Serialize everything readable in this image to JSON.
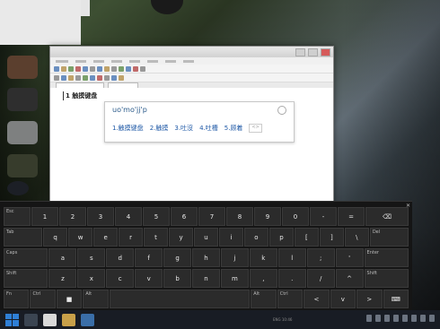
{
  "document": {
    "line_text": "1 触摸键盘"
  },
  "ime": {
    "input": "uo'mo'jj'p",
    "candidates": [
      "1.触摸键盘",
      "2.触摸",
      "3.吐沒",
      "4.吐槽",
      "5.顾着"
    ],
    "more_label": "<>"
  },
  "keyboard": {
    "rows": [
      [
        {
          "t": "Esc"
        },
        {
          "t": "1"
        },
        {
          "t": "2"
        },
        {
          "t": "3"
        },
        {
          "t": "4"
        },
        {
          "t": "5"
        },
        {
          "t": "6"
        },
        {
          "t": "7"
        },
        {
          "t": "8"
        },
        {
          "t": "9"
        },
        {
          "t": "0"
        },
        {
          "t": "-"
        },
        {
          "t": "="
        },
        {
          "t": "⌫"
        }
      ],
      [
        {
          "t": "Tab"
        },
        {
          "t": "q"
        },
        {
          "t": "w"
        },
        {
          "t": "e"
        },
        {
          "t": "r"
        },
        {
          "t": "t"
        },
        {
          "t": "y"
        },
        {
          "t": "u"
        },
        {
          "t": "i"
        },
        {
          "t": "o"
        },
        {
          "t": "p"
        },
        {
          "t": "["
        },
        {
          "t": "]"
        },
        {
          "t": "\\"
        },
        {
          "t": "Del"
        }
      ],
      [
        {
          "t": "Caps"
        },
        {
          "t": "a"
        },
        {
          "t": "s"
        },
        {
          "t": "d"
        },
        {
          "t": "f"
        },
        {
          "t": "g"
        },
        {
          "t": "h"
        },
        {
          "t": "j"
        },
        {
          "t": "k"
        },
        {
          "t": "l"
        },
        {
          "t": ";"
        },
        {
          "t": "'"
        },
        {
          "t": "Enter"
        }
      ],
      [
        {
          "t": "Shift"
        },
        {
          "t": "z"
        },
        {
          "t": "x"
        },
        {
          "t": "c"
        },
        {
          "t": "v"
        },
        {
          "t": "b"
        },
        {
          "t": "n"
        },
        {
          "t": "m"
        },
        {
          "t": ","
        },
        {
          "t": "."
        },
        {
          "t": "/"
        },
        {
          "t": "^"
        },
        {
          "t": "Shift"
        }
      ],
      [
        {
          "t": "Fn"
        },
        {
          "t": "Ctrl"
        },
        {
          "t": "■"
        },
        {
          "t": "Alt"
        },
        {
          "t": ""
        },
        {
          "t": "Alt"
        },
        {
          "t": "Ctrl"
        },
        {
          "t": "<"
        },
        {
          "t": "v"
        },
        {
          "t": ">"
        },
        {
          "t": "⌨"
        }
      ]
    ]
  },
  "tray": {
    "text": "ENG 10:46"
  },
  "colors": {
    "keyboard_bg": "#151515",
    "key_bg": "#2b2b2b",
    "candidate_text": "#1e58a6"
  }
}
